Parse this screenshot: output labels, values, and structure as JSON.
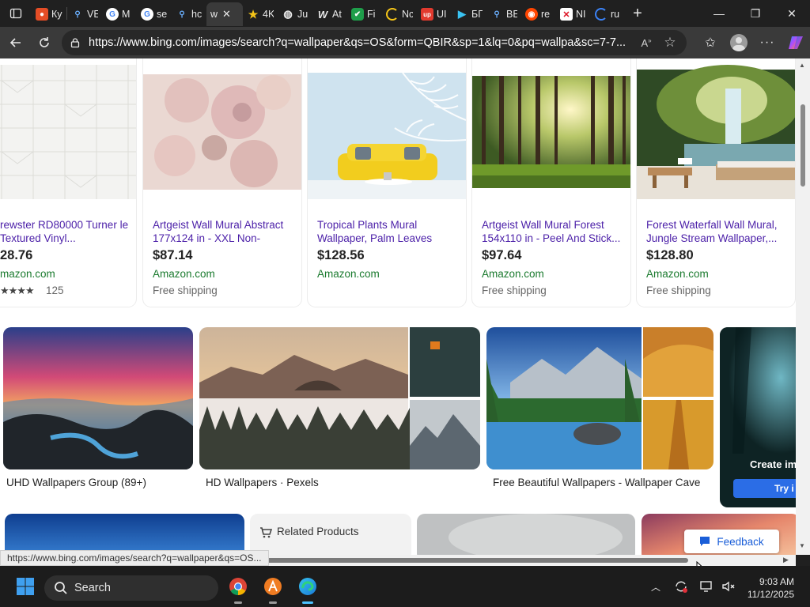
{
  "browser": {
    "tabs": [
      {
        "label": "Ку",
        "icon": "orange-red-icon"
      },
      {
        "label": "VE",
        "icon": "search-icon"
      },
      {
        "label": "M",
        "icon": "google-icon"
      },
      {
        "label": "se",
        "icon": "google-icon"
      },
      {
        "label": "hc",
        "icon": "search-icon"
      },
      {
        "label": "w",
        "icon": "bing-icon",
        "active": true
      },
      {
        "label": "4K",
        "icon": "star-icon"
      },
      {
        "label": "Ju",
        "icon": "globe-icon"
      },
      {
        "label": "At",
        "icon": "w-icon"
      },
      {
        "label": "Fi",
        "icon": "shield-icon"
      },
      {
        "label": "Nc",
        "icon": "loading-icon"
      },
      {
        "label": "UI",
        "icon": "up-icon"
      },
      {
        "label": "БГ",
        "icon": "play-icon"
      },
      {
        "label": "BE",
        "icon": "search-icon"
      },
      {
        "label": "re",
        "icon": "reddit-icon"
      },
      {
        "label": "NI",
        "icon": "red-x-icon"
      },
      {
        "label": "ru",
        "icon": "loading-icon"
      }
    ],
    "url": "https://www.bing.com/images/search?q=wallpaper&qs=OS&form=QBIR&sp=1&lq=0&pq=wallpa&sc=7-7..."
  },
  "products": [
    {
      "title": "rewster RD80000 Turner le Textured Vinyl...",
      "price": "28.76",
      "store": "mazon.com",
      "stars": "★★★★",
      "reviews": "125"
    },
    {
      "title": "Artgeist Wall Mural Abstract 177x124 in - XXL Non-Woven...",
      "price": "$87.14",
      "store": "Amazon.com",
      "shipping": "Free shipping"
    },
    {
      "title": "Tropical Plants Mural Wallpaper, Palm Leaves Mur...",
      "price": "$128.56",
      "store": "Amazon.com"
    },
    {
      "title": "Artgeist Wall Mural Forest 154x110 in - Peel And Stick...",
      "price": "$97.64",
      "store": "Amazon.com",
      "shipping": "Free shipping"
    },
    {
      "title": "Forest Waterfall Wall Mural, Jungle Stream Wallpaper,...",
      "price": "$128.80",
      "store": "Amazon.com",
      "shipping": "Free shipping"
    }
  ],
  "results": [
    {
      "caption": "UHD Wallpapers Group (89+)"
    },
    {
      "caption": "HD Wallpapers · Pexels"
    },
    {
      "caption": "Free Beautiful Wallpapers - Wallpaper Cave"
    },
    {
      "promo_title": "Create im",
      "promo_button": "Try i"
    }
  ],
  "related": {
    "label": "Related Products"
  },
  "feedback": {
    "label": "Feedback"
  },
  "status_url": "https://www.bing.com/images/search?q=wallpaper&qs=OS...",
  "taskbar": {
    "search_label": "Search",
    "time": "9:03 AM",
    "date": "11/12/2025"
  },
  "colors": {
    "accent": "#1a5ed8",
    "product_title": "#4b1fa8",
    "store_green": "#1a7a2e"
  }
}
